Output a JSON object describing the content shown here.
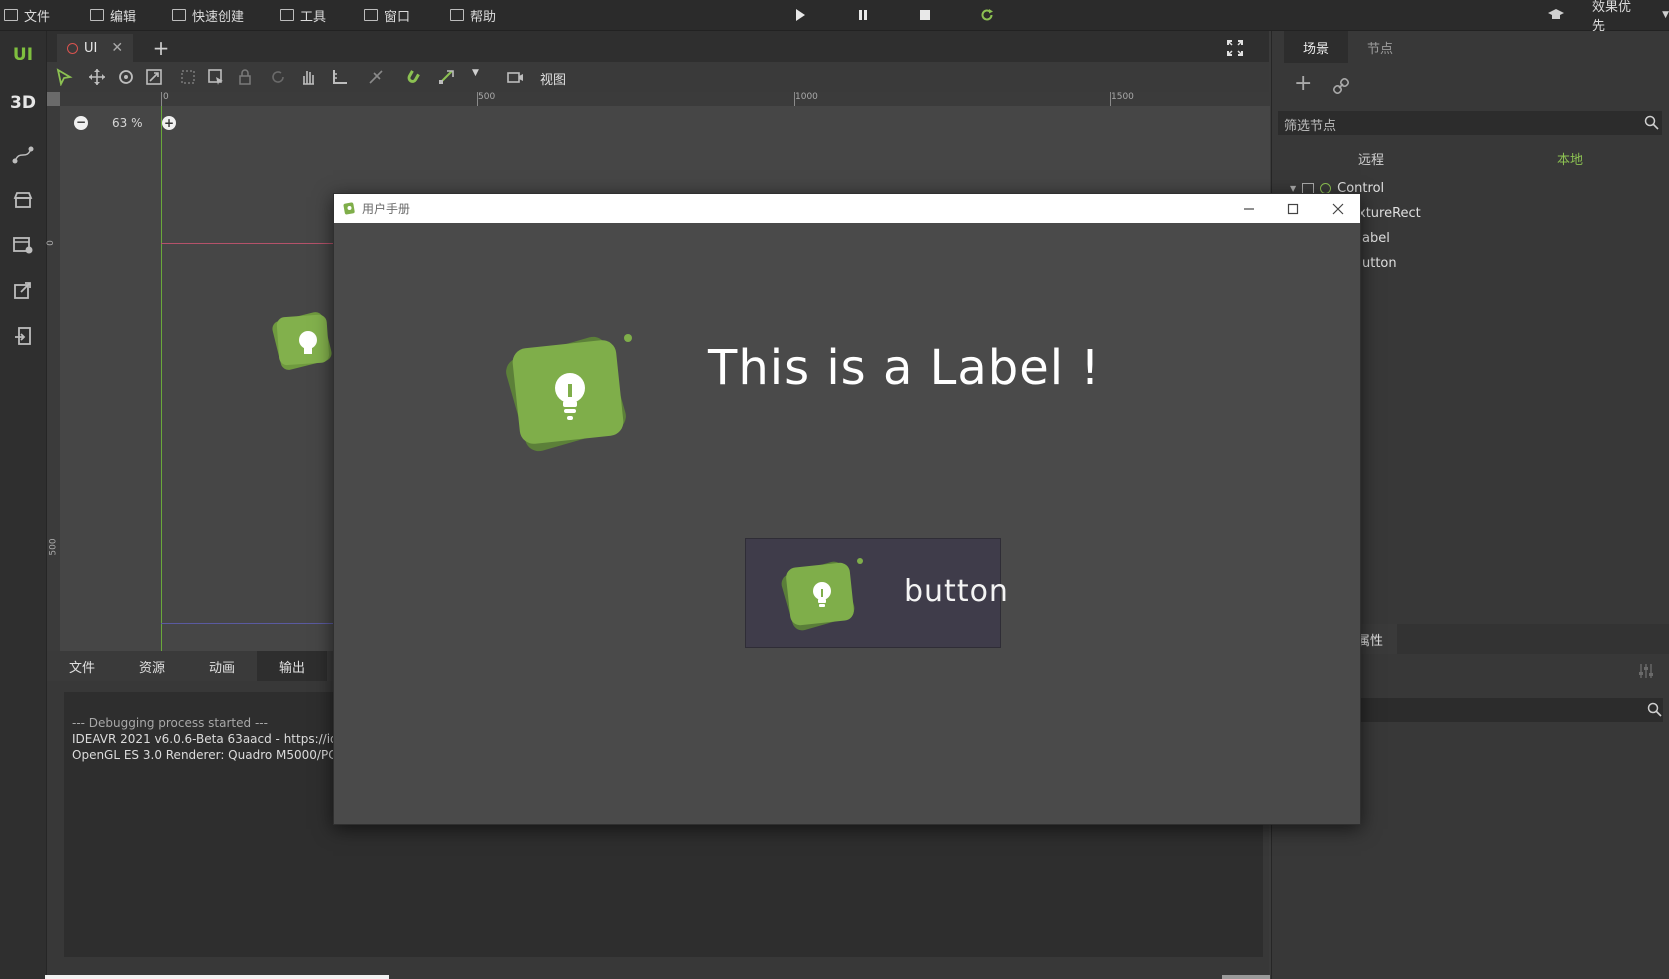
{
  "menubar": {
    "items": [
      {
        "label": "文件",
        "icon": "folder-icon"
      },
      {
        "label": "编辑",
        "icon": "crop-icon"
      },
      {
        "label": "快速创建",
        "icon": "edit-icon"
      },
      {
        "label": "工具",
        "icon": "window-icon"
      },
      {
        "label": "窗口",
        "icon": "frame-icon"
      },
      {
        "label": "帮助",
        "icon": "book-icon"
      }
    ],
    "quality_label": "效果优先"
  },
  "sidebar": {
    "mode_ui": "UI",
    "mode_3d": "3D"
  },
  "tabs": {
    "scene_tab": "UI",
    "add_tab": "+"
  },
  "toolbar": {
    "view_label": "视图"
  },
  "viewport": {
    "zoom": "63 %",
    "ruler_top": [
      "0",
      "500",
      "1000",
      "1500"
    ],
    "ruler_left": [
      "0",
      "500"
    ]
  },
  "bottom_panel": {
    "tabs": [
      "文件",
      "资源",
      "动画",
      "输出"
    ],
    "active_tab": "输出",
    "log_lines": [
      "--- Debugging process started ---",
      "IDEAVR 2021 v6.0.6-Beta 63aacd - https://ideav",
      "OpenGL ES 3.0 Renderer: Quadro M5000/PCIe/"
    ]
  },
  "right_panel": {
    "tabs": [
      "场景",
      "节点"
    ],
    "filter_placeholder": "筛选节点",
    "remote_label": "远程",
    "local_label": "本地",
    "tree": [
      {
        "label": "Control",
        "level": 0
      },
      {
        "label": "xtureRect",
        "level": 1
      },
      {
        "label": "abel",
        "level": 1
      },
      {
        "label": "utton",
        "level": 1
      }
    ],
    "inspector_tab": "属性"
  },
  "dialog": {
    "title": "用户手册",
    "label_text": "This is a Label !",
    "button_text": "button"
  },
  "colors": {
    "accent_green": "#6ea33b",
    "logo_green": "#7fae4a",
    "dialog_bg": "#4a4a4a",
    "button_bg": "#3f3c4a"
  }
}
